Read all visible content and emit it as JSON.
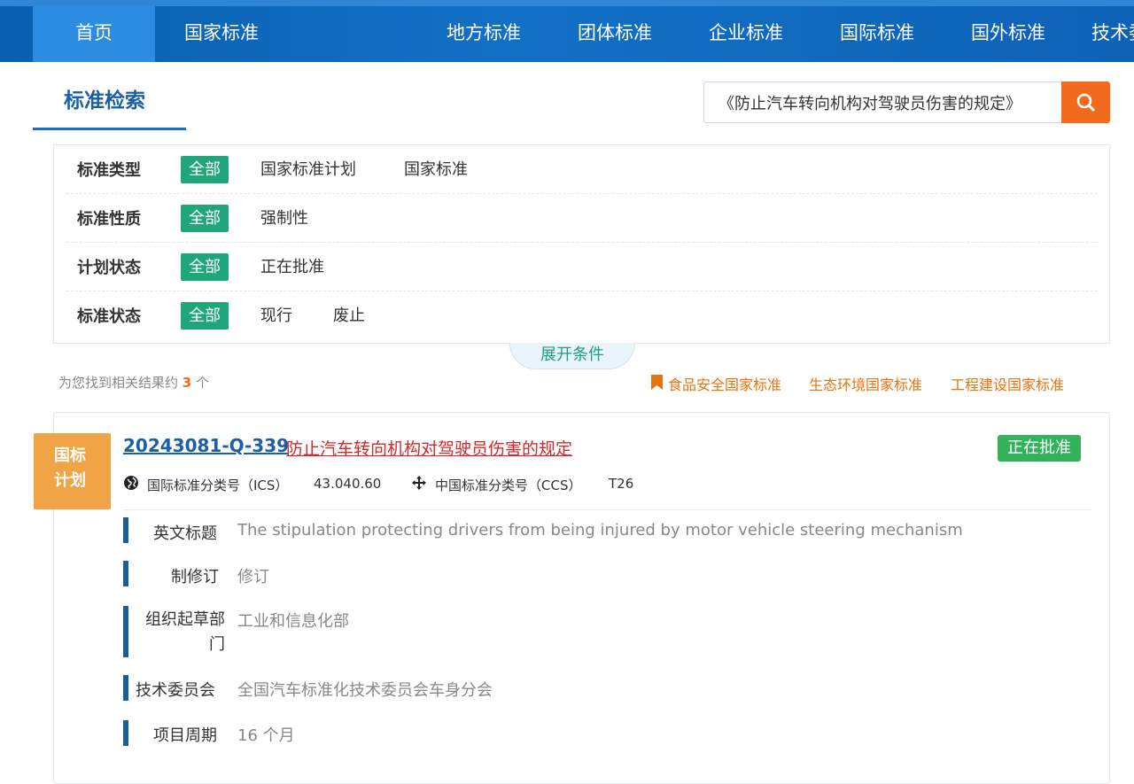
{
  "nav": {
    "items": [
      "首页",
      "国家标准",
      "地方标准",
      "团体标准",
      "企业标准",
      "国际标准",
      "国外标准",
      "技术委员会"
    ]
  },
  "search": {
    "title": "标准检索",
    "query": "《防止汽车转向机构对驾驶员伤害的规定》",
    "button_icon": "search-icon"
  },
  "filters": [
    {
      "label": "标准类型",
      "options": [
        "全部",
        "国家标准计划",
        "国家标准"
      ],
      "selected": "全部"
    },
    {
      "label": "标准性质",
      "options": [
        "全部",
        "强制性"
      ],
      "selected": "全部"
    },
    {
      "label": "计划状态",
      "options": [
        "全部",
        "正在批准"
      ],
      "selected": "全部"
    },
    {
      "label": "标准状态",
      "options": [
        "全部",
        "现行",
        "废止"
      ],
      "selected": "全部"
    }
  ],
  "expand_label": "展开条件",
  "results": {
    "prefix": "为您找到相关结果约",
    "count": "3",
    "suffix": "个"
  },
  "quick_links": [
    "食品安全国家标准",
    "生态环境国家标准",
    "工程建设国家标准"
  ],
  "item": {
    "tag_line1": "国标",
    "tag_line2": "计划",
    "code": "20243081-Q-339",
    "title": "防止汽车转向机构对驾驶员伤害的规定",
    "status": "正在批准",
    "ics_label": "国际标准分类号（ICS）",
    "ics_value": "43.040.60",
    "ccs_label": "中国标准分类号（CCS）",
    "ccs_value": "T26",
    "fields": [
      {
        "label": "英文标题",
        "value": "The stipulation protecting drivers from being injured by motor vehicle steering mechanism"
      },
      {
        "label": "制修订",
        "value": "修订"
      },
      {
        "label": "组织起草部门",
        "value": "工业和信息化部"
      },
      {
        "label": "技术委员会",
        "value": "全国汽车标准化技术委员会车身分会"
      },
      {
        "label": "项目周期",
        "value": "16 个月"
      }
    ]
  },
  "colors": {
    "nav_bg": "#1270c4",
    "nav_active": "#2b8ce0",
    "chip_selected": "#1fa67a",
    "search_button": "#f26a1b",
    "tag_plan": "#f0a445",
    "status_badge": "#33b15b",
    "title_red": "#d2282c",
    "link_orange": "#e8730f"
  }
}
